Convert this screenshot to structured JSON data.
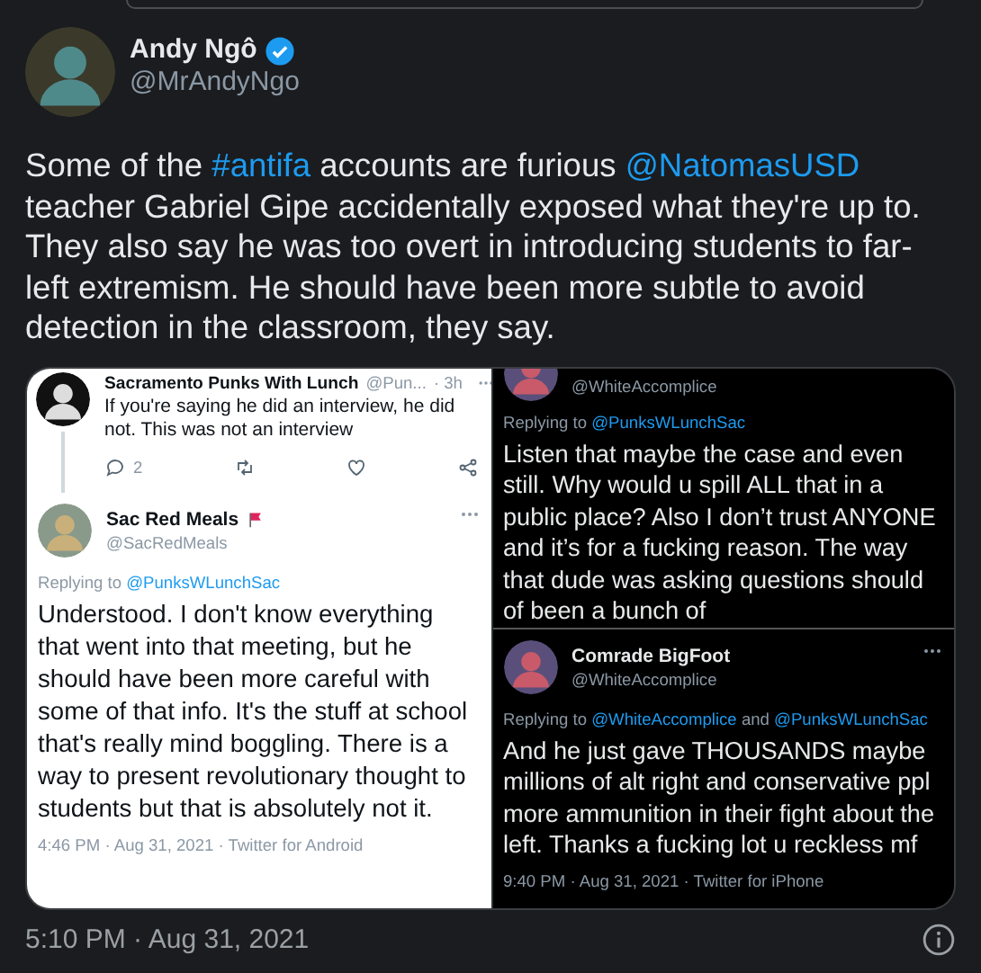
{
  "tweet": {
    "author": {
      "name": "Andy Ngô",
      "handle": "@MrAndyNgo",
      "verified": true
    },
    "text": [
      {
        "kind": "plain",
        "text": "Some of the "
      },
      {
        "kind": "link",
        "text": "#antifa"
      },
      {
        "kind": "plain",
        "text": " accounts are furious "
      },
      {
        "kind": "link",
        "text": "@NatomasUSD"
      },
      {
        "kind": "plain",
        "text": " teacher Gabriel Gipe accidentally exposed what they're up to. They also say he was too overt in introducing students to far-left extremism. He should have been more subtle to avoid detection in the classroom, they say."
      }
    ],
    "media": [
      {
        "kind": "light",
        "crops": [
          {
            "tweets": [
              {
                "kind": "compact",
                "name": "Sacramento Punks With Lunch",
                "handle": "@Pun...",
                "time": "· 3h",
                "flag": false,
                "text": "If you're saying he did an interview, he did not. This was not an interview",
                "reply_count": "2"
              },
              {
                "kind": "detail",
                "name": "Sac Red Meals",
                "flag": true,
                "handle": "@SacRedMeals",
                "replying": [
                  {
                    "kind": "plain",
                    "text": "Replying to "
                  },
                  {
                    "kind": "link",
                    "text": "@PunksWLunchSac"
                  }
                ],
                "text": "Understood. I don't know everything that went into that meeting, but he should have been more careful with some of that info. It's the stuff at school that's really mind boggling. There is a way to present revolutionary thought to students but that is absolutely not it.",
                "footer": "4:46 PM · Aug 31, 2021 · Twitter for Android"
              }
            ]
          }
        ]
      },
      {
        "kind": "dark",
        "crops": [
          {
            "tweets": [
              {
                "kind": "detail",
                "handle": "@WhiteAccomplice",
                "replying": [
                  {
                    "kind": "plain",
                    "text": "Replying to "
                  },
                  {
                    "kind": "link",
                    "text": "@PunksWLunchSac"
                  }
                ],
                "text": "Listen that maybe the case and even still. Why would u spill ALL that in a public place? Also I don’t trust ANYONE and it’s for a fucking reason. The way that dude was asking questions should of been a bunch of"
              }
            ]
          },
          {
            "tweets": [
              {
                "kind": "detail",
                "name": "Comrade BigFoot",
                "flag": false,
                "handle": "@WhiteAccomplice",
                "replying": [
                  {
                    "kind": "plain",
                    "text": "Replying to "
                  },
                  {
                    "kind": "link",
                    "text": "@WhiteAccomplice"
                  },
                  {
                    "kind": "plain",
                    "text": " and "
                  },
                  {
                    "kind": "link",
                    "text": "@PunksWLunchSac"
                  }
                ],
                "text": "And he just gave THOUSANDS maybe millions of alt right and conservative ppl more ammunition in their fight about the left. Thanks a fucking lot u reckless mf",
                "footer": "9:40 PM · Aug 31, 2021 · Twitter for iPhone"
              }
            ]
          }
        ]
      }
    ],
    "timestamp": "5:10 PM · Aug 31, 2021"
  }
}
